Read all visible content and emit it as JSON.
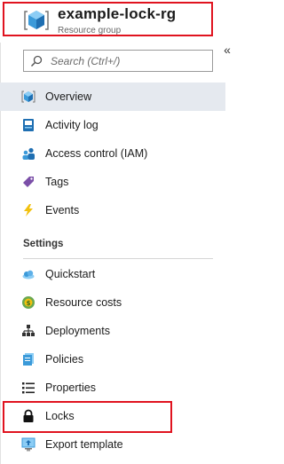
{
  "header": {
    "title": "example-lock-rg",
    "subtitle": "Resource group",
    "icon": "resource-group-icon",
    "collapse_glyph": "«"
  },
  "search": {
    "placeholder": "Search (Ctrl+/)"
  },
  "nav": {
    "top_items": [
      {
        "label": "Overview",
        "icon": "resource-group-icon",
        "active": true
      },
      {
        "label": "Activity log",
        "icon": "activity-log-icon"
      },
      {
        "label": "Access control (IAM)",
        "icon": "users-icon"
      },
      {
        "label": "Tags",
        "icon": "tag-icon"
      },
      {
        "label": "Events",
        "icon": "lightning-icon"
      }
    ],
    "settings_label": "Settings",
    "settings_items": [
      {
        "label": "Quickstart",
        "icon": "cloud-icon"
      },
      {
        "label": "Resource costs",
        "icon": "cost-icon"
      },
      {
        "label": "Deployments",
        "icon": "deployments-icon"
      },
      {
        "label": "Policies",
        "icon": "policies-icon"
      },
      {
        "label": "Properties",
        "icon": "properties-list-icon"
      },
      {
        "label": "Locks",
        "icon": "lock-icon"
      },
      {
        "label": "Export template",
        "icon": "export-template-icon"
      }
    ]
  },
  "colors": {
    "highlight": "#e0131f",
    "active_bg": "#e5e9ef",
    "azure_blue": "#0078d4"
  }
}
